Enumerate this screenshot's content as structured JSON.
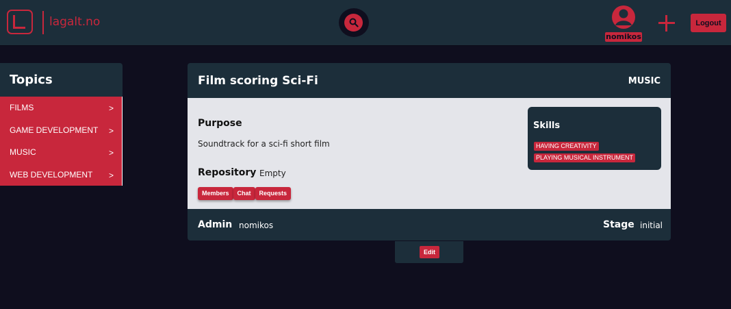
{
  "app": {
    "logo_text": "lagalt.no"
  },
  "header": {
    "search_icon": "search-icon",
    "avatar_icon": "user-avatar-icon",
    "username": "nomikos",
    "add_icon": "plus-icon",
    "logout_label": "Logout"
  },
  "sidebar": {
    "title": "Topics",
    "items": [
      {
        "label": "FILMS"
      },
      {
        "label": "GAME DEVELOPMENT"
      },
      {
        "label": "MUSIC"
      },
      {
        "label": "WEB DEVELOPMENT"
      }
    ],
    "chevron": ">"
  },
  "project": {
    "title": "Film scoring Sci-Fi",
    "category": "MUSIC",
    "purpose_label": "Purpose",
    "purpose_text": "Soundtrack for a sci-fi short film",
    "repository_label": "Repository",
    "repository_value": "Empty",
    "tabs": [
      {
        "label": "Members"
      },
      {
        "label": "Chat"
      },
      {
        "label": "Requests"
      }
    ],
    "skills_title": "Skills",
    "skills": [
      {
        "label": "HAVING CREATIVITY"
      },
      {
        "label": "PLAYING MUSICAL INSTRUMENT"
      }
    ],
    "admin_label": "Admin",
    "admin_value": "nomikos",
    "stage_label": "Stage",
    "stage_value": "initial",
    "edit_label": "Edit"
  },
  "colors": {
    "background": "#0f0e1e",
    "panel": "#1c2e3a",
    "accent": "#c8273c",
    "card_body": "#e4e5ea"
  }
}
